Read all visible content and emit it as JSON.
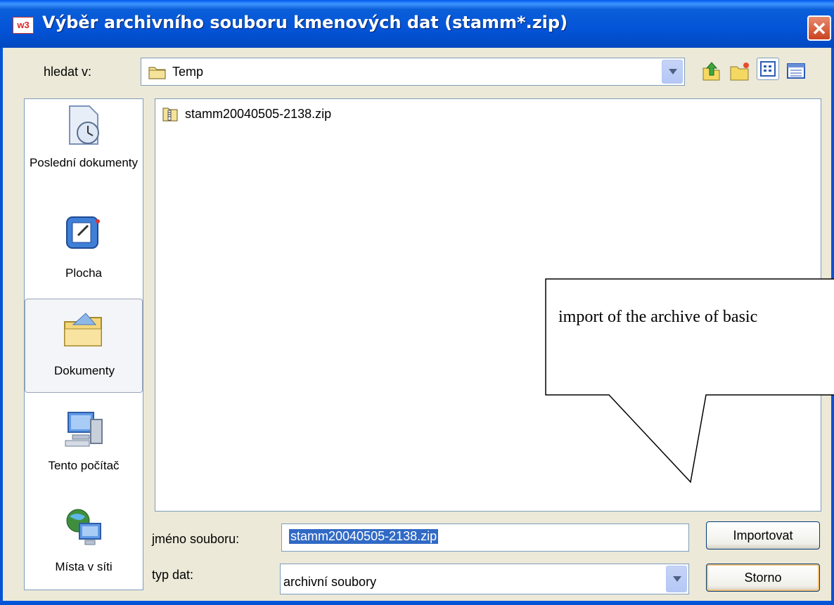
{
  "window": {
    "title_icon": "w3",
    "title": "Výběr archivního souboru kmenových dat (stamm*.zip)",
    "close_symbol": "✕"
  },
  "lookin": {
    "label": "hledat v:",
    "value": "Temp",
    "icons": [
      "up-folder-icon",
      "new-folder-icon",
      "list-view-icon",
      "details-view-icon"
    ]
  },
  "places": [
    {
      "label": "Poslední dokumenty",
      "icon": "recent-documents-icon"
    },
    {
      "label": "Plocha",
      "icon": "desktop-icon"
    },
    {
      "label": "Dokumenty",
      "icon": "my-documents-icon"
    },
    {
      "label": "Tento počítač",
      "icon": "my-computer-icon"
    },
    {
      "label": "Místa v síti",
      "icon": "network-places-icon"
    }
  ],
  "files": [
    {
      "name": "stamm20040505-2138.zip",
      "icon": "zip-file-icon"
    }
  ],
  "filename": {
    "label": "jméno souboru:",
    "value": "stamm20040505-2138.zip"
  },
  "filetype": {
    "label": "typ dat:",
    "value": "archivní soubory"
  },
  "buttons": {
    "import": "Importovat",
    "cancel": "Storno"
  },
  "callout": {
    "text": "import of the archive of  basic"
  },
  "colors": {
    "titlebar": "#0454D8",
    "dialog_bg": "#ECE9D8",
    "selection": "#316AC5",
    "close": "#C94420"
  }
}
